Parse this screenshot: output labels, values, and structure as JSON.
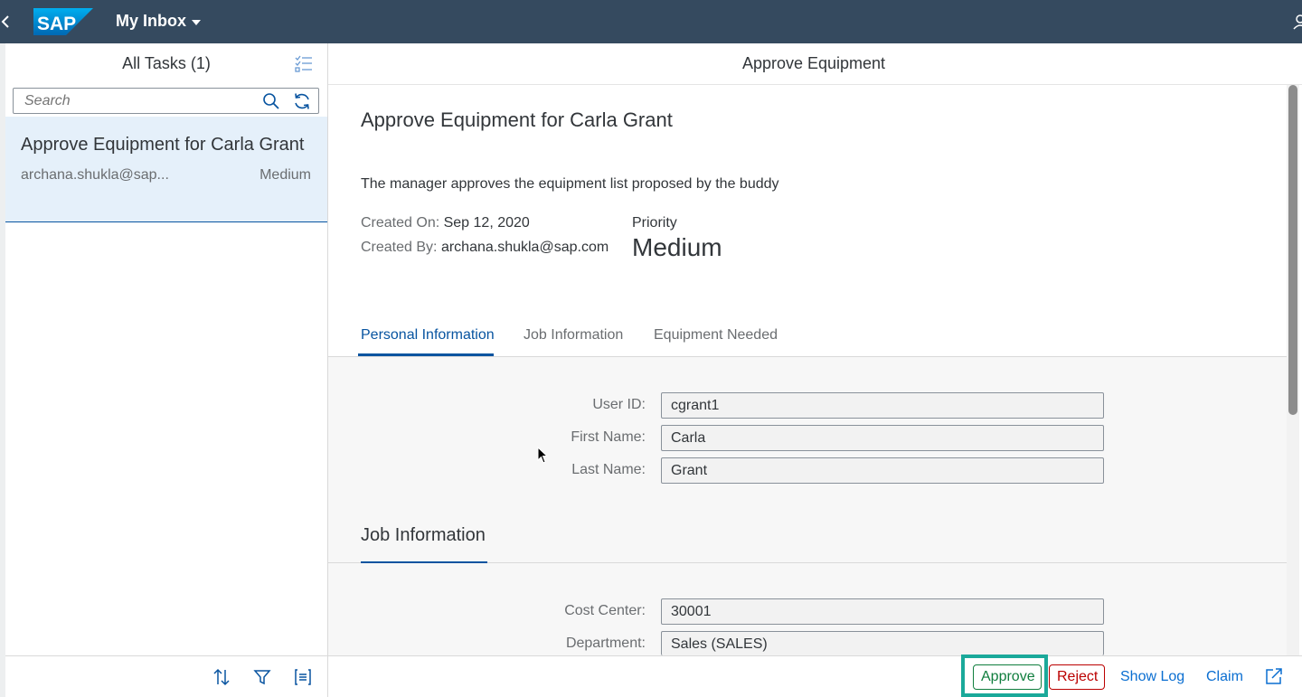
{
  "shell": {
    "title": "My Inbox",
    "logo_text": "SAP",
    "icons": [
      "back-icon",
      "user-icon"
    ],
    "header_color": "#354a5f"
  },
  "master": {
    "title": "All Tasks (1)",
    "search_placeholder": "Search",
    "tasks": [
      {
        "title": "Approve Equipment for Carla Grant",
        "created_by": "archana.shukla@sap...",
        "priority": "Medium"
      }
    ],
    "footer_icons": [
      "sort-icon",
      "filter-icon",
      "group-icon"
    ]
  },
  "detail": {
    "header_title": "Approve Equipment",
    "object_title": "Approve Equipment for Carla Grant",
    "description": "The manager approves the equipment list proposed by the buddy",
    "created_on_label": "Created On:",
    "created_on": "Sep 12, 2020",
    "created_by_label": "Created By:",
    "created_by": "archana.shukla@sap.com",
    "priority_label": "Priority",
    "priority_value": "Medium",
    "tabs": [
      {
        "label": "Personal Information",
        "active": true
      },
      {
        "label": "Job Information",
        "active": false
      },
      {
        "label": "Equipment Needed",
        "active": false
      }
    ],
    "personal": {
      "user_id_label": "User ID:",
      "user_id": "cgrant1",
      "first_name_label": "First Name:",
      "first_name": "Carla",
      "last_name_label": "Last Name:",
      "last_name": "Grant"
    },
    "job_section_title": "Job Information",
    "job": {
      "cost_center_label": "Cost Center:",
      "cost_center": "30001",
      "department_label": "Department:",
      "department": "Sales (SALES)"
    },
    "actions": {
      "approve": "Approve",
      "reject": "Reject",
      "show_log": "Show Log",
      "claim": "Claim"
    },
    "colors": {
      "accent": "#0854a0",
      "approve": "#107e3e",
      "reject": "#bb0000",
      "highlight": "#1aa99a"
    }
  }
}
